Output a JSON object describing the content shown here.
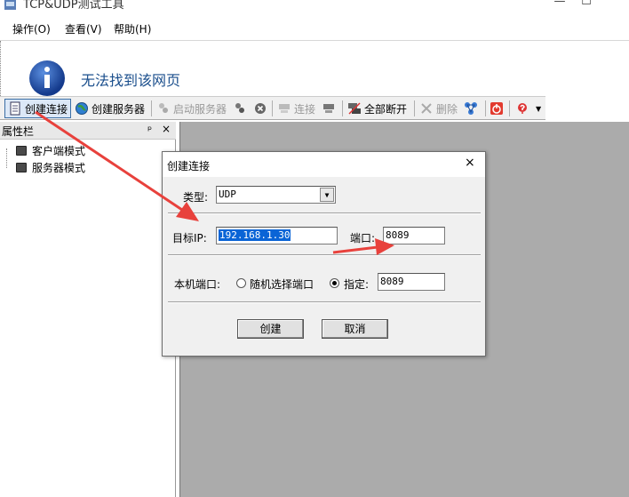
{
  "window": {
    "title": "TCP&UDP测试工具",
    "minimize": "—",
    "maximize": "☐"
  },
  "menu": [
    {
      "label": "操作(O)"
    },
    {
      "label": "查看(V)"
    },
    {
      "label": "帮助(H)"
    }
  ],
  "browser": {
    "message": "无法找到该网页"
  },
  "toolbar": {
    "create_connection": "创建连接",
    "create_server": "创建服务器",
    "start_server": "启动服务器",
    "connect": "连接",
    "disconnect_all": "全部断开",
    "delete": "删除"
  },
  "panel": {
    "title": "属性栏",
    "pin": "ᵖ",
    "close": "×",
    "items": [
      {
        "label": "客户端模式"
      },
      {
        "label": "服务器模式"
      }
    ]
  },
  "dialog": {
    "title": "创建连接",
    "close": "×",
    "type_label": "类型:",
    "type_value": "UDP",
    "target_ip_label": "目标IP:",
    "target_ip_value": "192.168.1.30",
    "port_label": "端口:",
    "port_value": "8089",
    "local_port_label": "本机端口:",
    "random_port_label": "随机选择端口",
    "specify_label": "指定:",
    "specify_value": "8089",
    "specify_selected": true,
    "create_button": "创建",
    "cancel_button": "取消"
  },
  "colors": {
    "arrow": "#e8413c",
    "workspace": "#ababab",
    "selection": "#0a64d6"
  }
}
